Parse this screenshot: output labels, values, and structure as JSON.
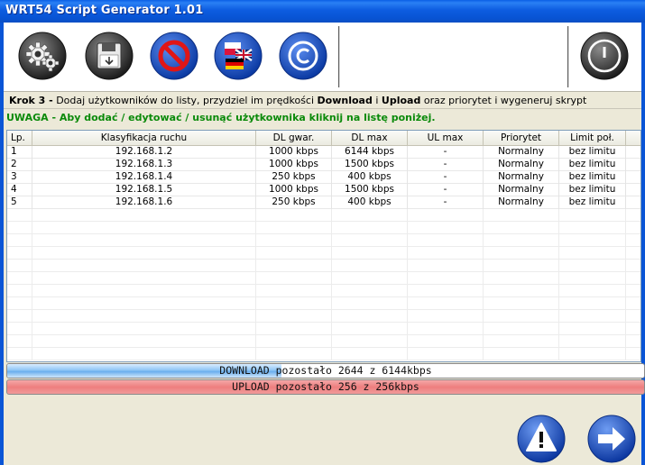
{
  "window": {
    "title": "WRT54 Script Generator 1.01"
  },
  "toolbar": {
    "buttons": [
      {
        "name": "settings-gears",
        "icon": "gears-icon"
      },
      {
        "name": "save-floppy",
        "icon": "floppy-disk-icon"
      },
      {
        "name": "block",
        "icon": "no-entry-icon"
      },
      {
        "name": "language",
        "icon": "flags-icon"
      },
      {
        "name": "copyright",
        "icon": "copyright-icon"
      },
      {
        "name": "power",
        "icon": "power-icon"
      }
    ]
  },
  "step": {
    "prefix": "Krok 3 -",
    "text_a": " Dodaj użytkowników do listy, przydziel im prędkości ",
    "bold_a": "Download",
    "text_b": " i ",
    "bold_b": "Upload",
    "text_c": " oraz priorytet i wygeneruj skrypt"
  },
  "warning": "UWAGA - Aby dodać / edytować / usunąć użytkownika kliknij na listę poniżej.",
  "table": {
    "columns": [
      "Lp.",
      "Klasyfikacja ruchu",
      "DL gwar.",
      "DL max",
      "UL max",
      "Priorytet",
      "Limit poł."
    ],
    "rows": [
      [
        "1",
        "192.168.1.2",
        "1000 kbps",
        "6144 kbps",
        "-",
        "Normalny",
        "bez limitu"
      ],
      [
        "2",
        "192.168.1.3",
        "1000 kbps",
        "1500 kbps",
        "-",
        "Normalny",
        "bez limitu"
      ],
      [
        "3",
        "192.168.1.4",
        "250 kbps",
        "400 kbps",
        "-",
        "Normalny",
        "bez limitu"
      ],
      [
        "4",
        "192.168.1.5",
        "1000 kbps",
        "1500 kbps",
        "-",
        "Normalny",
        "bez limitu"
      ],
      [
        "5",
        "192.168.1.6",
        "250 kbps",
        "400 kbps",
        "-",
        "Normalny",
        "bez limitu"
      ]
    ]
  },
  "download_bar": {
    "label": "DOWNLOAD pozostało 2644 z 6144kbps",
    "fill_fraction": 0.43
  },
  "upload_bar": {
    "label": "UPLOAD pozostało 256 z 256kbps",
    "fill_fraction": 1.0
  },
  "colors": {
    "titlebar": "#0a55d6",
    "warning_text": "#0a8a0a",
    "upload_bar": "#ee7f7f",
    "download_fill": "#6aaeee",
    "round_button": "#1a56c8"
  },
  "bottom_buttons": [
    {
      "name": "warning",
      "icon": "exclamation-icon"
    },
    {
      "name": "next",
      "icon": "arrow-right-icon"
    }
  ]
}
